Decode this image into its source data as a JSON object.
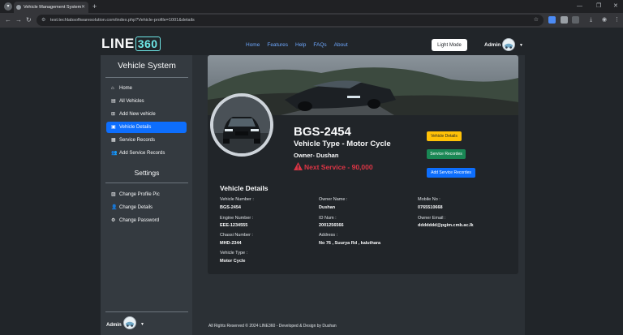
{
  "browser": {
    "tab_title": "Vehicle Management System",
    "url": "test.techlabsoftwaresolution.com/index.php?Vehicle-profile=1001&details"
  },
  "nav": {
    "logo_text": "LINE",
    "logo_box": "360",
    "links": [
      "Home",
      "Features",
      "Help",
      "FAQs",
      "About"
    ],
    "light_mode": "Light Mode",
    "admin": "Admin"
  },
  "sidebar": {
    "title": "Vehicle System",
    "items": [
      {
        "label": "Home",
        "icon": "home-icon"
      },
      {
        "label": "All Vehicles",
        "icon": "list-icon"
      },
      {
        "label": "Add New vehicle",
        "icon": "plus-icon"
      },
      {
        "label": "Vehicle Details",
        "icon": "card-icon"
      },
      {
        "label": "Service Records",
        "icon": "document-icon"
      },
      {
        "label": "Add Service Records",
        "icon": "users-icon"
      }
    ],
    "settings_title": "Settings",
    "settings_items": [
      {
        "label": "Change Profile Pic",
        "icon": "image-icon"
      },
      {
        "label": "Change Details",
        "icon": "user-edit-icon"
      },
      {
        "label": "Change Password",
        "icon": "gear-icon"
      }
    ],
    "admin": "Admin",
    "active_item": "Vehicle Details"
  },
  "profile": {
    "vehicle_number": "BGS-2454",
    "vehicle_type": "Vehicle Type - Motor Cycle",
    "owner": "Owner- Dushan",
    "next_service": "Next Service - 90,000"
  },
  "buttons": {
    "details": "Vehicle Details",
    "records": "Service Recordes",
    "add_records": "Add Service Recordes"
  },
  "details": {
    "title": "Vehicle Details",
    "fields": {
      "vehicle_number": {
        "label": "Vehicle Number :",
        "value": "BGS-2454"
      },
      "engine_number": {
        "label": "Engine Number :",
        "value": "EEE-1234555"
      },
      "chassi_number": {
        "label": "Chassi Number :",
        "value": "MHD-2344"
      },
      "vehicle_type": {
        "label": "Vehicle Type :",
        "value": "Motor Cycle"
      },
      "owner_name": {
        "label": "Owner Name :",
        "value": "Dushan"
      },
      "id_num": {
        "label": "ID Num :",
        "value": "2001256566"
      },
      "address": {
        "label": "Address :",
        "value": "No 76 , Suurya Rd , kaluthara"
      },
      "mobile_no": {
        "label": "Mobile No :",
        "value": "0765510668"
      },
      "owner_email": {
        "label": "Owner Email :",
        "value": "ddddddd@pgim.cmb.ac.lk"
      }
    }
  },
  "footer": "All Rights Reserved © 2024 LINE360 - Developed & Design by Dushan",
  "colors": {
    "active": "#0d6efd",
    "warning": "#ffc107",
    "success": "#198754",
    "danger": "#dc3545"
  }
}
